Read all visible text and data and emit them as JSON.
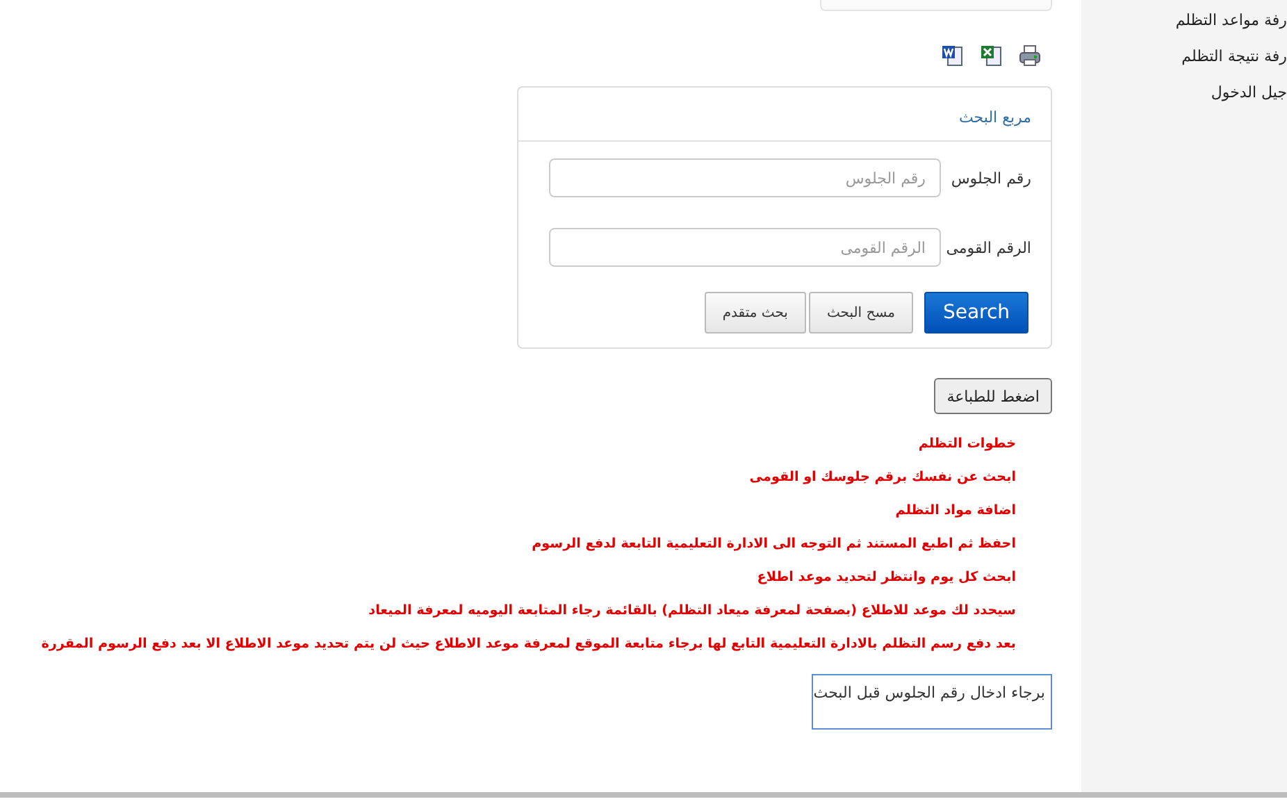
{
  "sidebar": {
    "items": [
      {
        "label": "رفة مواعد التظلم"
      },
      {
        "label": "رفة نتيجة التظلم"
      },
      {
        "label": "جيل الدخول"
      }
    ]
  },
  "export_icons": [
    {
      "kind": "print"
    },
    {
      "kind": "excel"
    },
    {
      "kind": "word"
    }
  ],
  "search_box": {
    "title": "مربع البحث",
    "fields": [
      {
        "label": "رقم الجلوس",
        "placeholder": "رقم الجلوس"
      },
      {
        "label": "الرقم القومى",
        "placeholder": "الرقم القومى"
      }
    ],
    "buttons": [
      {
        "label": "Search",
        "kind": "primary"
      },
      {
        "label": "مسح البحث",
        "kind": "default"
      },
      {
        "label": "بحث متقدم",
        "kind": "default"
      }
    ]
  },
  "print_button": "اضغط للطباعة",
  "steps": [
    "خطوات التظلم",
    "ابحث عن نفسك برقم جلوسك او القومى",
    "اضافة مواد التظلم",
    "احفظ ثم اطبع المستند ثم التوجه الى الادارة التعليمية التابعة لدفع الرسوم",
    "ابحث كل يوم وانتظر لتحديد موعد اطلاع",
    "سيحدد لك موعد للاطلاع (بصفحة لمعرفة ميعاد التظلم) بالقائمة رجاء المتابعة اليوميه لمعرفة الميعاد",
    "بعد دفع رسم التظلم بالادارة التعليمية التابع لها برجاء متابعة الموقع لمعرفة موعد الاطلاع حيث لن يتم تحديد موعد الاطلاع الا بعد دفع الرسوم المقررة"
  ],
  "message": "برجاء ادخال رقم الجلوس قبل البحث"
}
